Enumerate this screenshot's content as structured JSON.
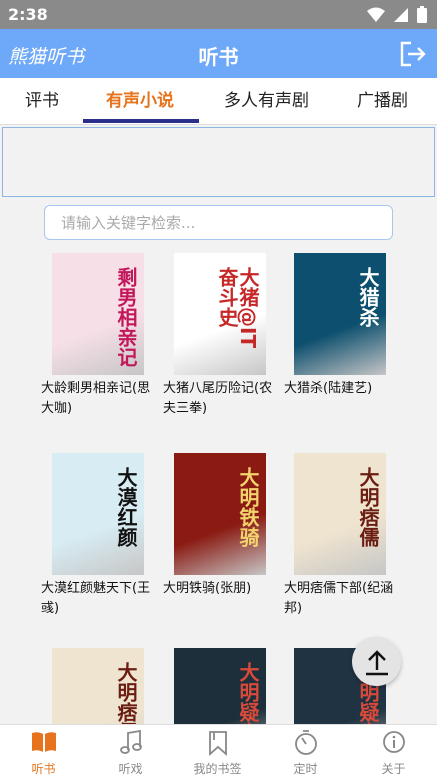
{
  "status": {
    "time": "2:38"
  },
  "appbar": {
    "brand": "熊猫听书",
    "title": "听书"
  },
  "tabs": [
    {
      "label": "评书"
    },
    {
      "label": "有声小说"
    },
    {
      "label": "多人有声剧"
    },
    {
      "label": "广播剧"
    }
  ],
  "search": {
    "placeholder": "请输入关键字检索..."
  },
  "books": [
    {
      "caption": "大龄剩男相亲记(思大咖)",
      "cover_text": "剩男相亲记",
      "cover_color": "#f6dfe7",
      "accent": "#c2185b"
    },
    {
      "caption": "大猪八尾历险记(农夫三拳)",
      "cover_text": "大猪@IT奋斗史",
      "cover_color": "#ffffff",
      "accent": "#c62828"
    },
    {
      "caption": "大猎杀(陆建艺)",
      "cover_text": "大猎杀",
      "cover_color": "#0d4f6e",
      "accent": "#ffffff"
    },
    {
      "caption": "大漠红颜魅天下(王彧)",
      "cover_text": "大漠红颜",
      "cover_color": "#d7ecf3",
      "accent": "#111111"
    },
    {
      "caption": "大明铁骑(张朋)",
      "cover_text": "大明铁骑",
      "cover_color": "#8a1a12",
      "accent": "#f3d36b"
    },
    {
      "caption": "大明痞儒下部(纪涵邦)",
      "cover_text": "大明痞儒",
      "cover_color": "#efe4cf",
      "accent": "#6b1d12"
    },
    {
      "caption": "",
      "cover_text": "大明痞儒",
      "cover_color": "#efe4cf",
      "accent": "#6b1d12"
    },
    {
      "caption": "",
      "cover_text": "大明疑案",
      "cover_color": "#1d2f3a",
      "accent": "#d94a3a"
    },
    {
      "caption": "",
      "cover_text": "大明疑案",
      "cover_color": "#1f3342",
      "accent": "#d94a3a"
    }
  ],
  "nav": [
    {
      "label": "听书",
      "icon": "book-open-icon"
    },
    {
      "label": "听戏",
      "icon": "music-note-icon"
    },
    {
      "label": "我的书签",
      "icon": "bookmark-icon"
    },
    {
      "label": "定时",
      "icon": "timer-icon"
    },
    {
      "label": "关于",
      "icon": "info-icon"
    }
  ],
  "colors": {
    "accent": "#e7741d",
    "appbar": "#6ea8f8",
    "indicator": "#2b2f8c"
  }
}
